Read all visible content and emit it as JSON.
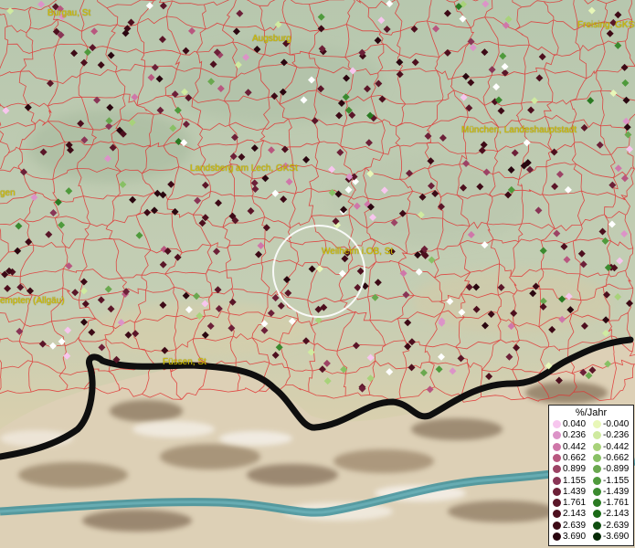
{
  "colors": {
    "boundary": "#e03030",
    "border": "#111111",
    "label": "#d4c000",
    "marker_positive": [
      "#f7c6ee",
      "#dc93c8",
      "#cf77a9",
      "#b8577f",
      "#9c4365",
      "#893556",
      "#6c2038",
      "#5a1628",
      "#4d0f1e",
      "#3d0a16",
      "#2a0710"
    ],
    "marker_negative": [
      "#e8f7b8",
      "#cfeaa0",
      "#a8d27a",
      "#88c065",
      "#6aa84f",
      "#4f9a3c",
      "#3b8a2f",
      "#2a7a22",
      "#1a6a16",
      "#0f4e10",
      "#072a07"
    ]
  },
  "cities": [
    {
      "name": "Burgau, St"
    },
    {
      "name": "Augsburg"
    },
    {
      "name": "Freising, GKSt"
    },
    {
      "name": "München, Landeshauptstadt"
    },
    {
      "name": "Landsberg am Lech, GKSt"
    },
    {
      "name": "Weilheim i.OB, St"
    },
    {
      "name": "Füssen, St"
    },
    {
      "name": "empten (Allgäu)"
    },
    {
      "name": "gen"
    }
  ],
  "legend": {
    "title": "%/Jahr",
    "positive": [
      "0.040",
      "0.236",
      "0.442",
      "0.662",
      "0.899",
      "1.155",
      "1.439",
      "1.761",
      "2.143",
      "2.639",
      "3.690"
    ],
    "negative": [
      "-0.040",
      "-0.236",
      "-0.442",
      "-0.662",
      "-0.899",
      "-1.155",
      "-1.439",
      "-1.761",
      "-2.143",
      "-2.639",
      "-3.690"
    ]
  }
}
